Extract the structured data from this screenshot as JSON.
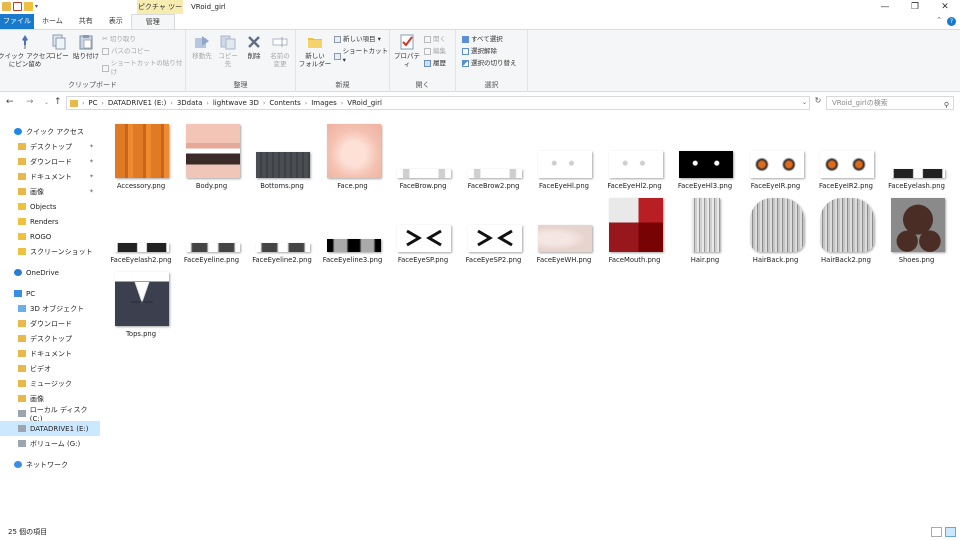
{
  "window": {
    "context_tab": "ピクチャ ツール",
    "title": "VRoid_girl"
  },
  "ribbon_tabs": [
    "ファイル",
    "ホーム",
    "共有",
    "表示",
    "管理"
  ],
  "ribbon": {
    "clipboard": {
      "label": "クリップボード",
      "pin": "クイック アクセス\nにピン留め",
      "copy": "コピー",
      "paste": "貼り付け",
      "cut": "切り取り",
      "copy_path": "パスのコピー",
      "paste_shortcut": "ショートカットの貼り付け"
    },
    "organize": {
      "label": "整理",
      "move_to": "移動先",
      "copy_to": "コピー先",
      "delete": "削除",
      "rename": "名前の\n変更"
    },
    "new": {
      "label": "新規",
      "new_folder": "新しい\nフォルダー",
      "new_item": "新しい項目 ▾",
      "shortcut": "ショートカット ▾"
    },
    "open": {
      "label": "開く",
      "properties": "プロパティ",
      "open": "開く",
      "edit": "編集",
      "history": "履歴"
    },
    "select": {
      "label": "選択",
      "select_all": "すべて選択",
      "select_none": "選択解除",
      "invert": "選択の切り替え"
    }
  },
  "address": {
    "crumbs": [
      "PC",
      "DATADRIVE1 (E:)",
      "3Ddata",
      "lightwave 3D",
      "Contents",
      "Images",
      "VRoid_girl"
    ],
    "search_placeholder": "VRoid_girlの検索"
  },
  "nav": [
    {
      "label": "クイック アクセス",
      "icon": "star-icon",
      "indent": 0,
      "pinned": false,
      "color": "#1e88e5"
    },
    {
      "label": "デスクトップ",
      "icon": "folder-icon",
      "indent": 1,
      "pinned": true,
      "color": "#e8b84a"
    },
    {
      "label": "ダウンロード",
      "icon": "download-folder-icon",
      "indent": 1,
      "pinned": true,
      "color": "#e8b84a"
    },
    {
      "label": "ドキュメント",
      "icon": "document-folder-icon",
      "indent": 1,
      "pinned": true,
      "color": "#e8b84a"
    },
    {
      "label": "画像",
      "icon": "picture-folder-icon",
      "indent": 1,
      "pinned": true,
      "color": "#e8b84a"
    },
    {
      "label": "Objects",
      "icon": "folder-icon",
      "indent": 1,
      "pinned": false,
      "color": "#f0c040"
    },
    {
      "label": "Renders",
      "icon": "folder-icon",
      "indent": 1,
      "pinned": false,
      "color": "#f0c040"
    },
    {
      "label": "ROGO",
      "icon": "folder-icon",
      "indent": 1,
      "pinned": false,
      "color": "#f0c040"
    },
    {
      "label": "スクリーンショット",
      "icon": "folder-icon",
      "indent": 1,
      "pinned": false,
      "color": "#f0c040"
    },
    {
      "label": "OneDrive",
      "icon": "cloud-icon",
      "indent": 0,
      "pinned": false,
      "color": "#2b7cd3",
      "gap": true
    },
    {
      "label": "PC",
      "icon": "pc-icon",
      "indent": 0,
      "pinned": false,
      "color": "#3a8ee6",
      "gap": true
    },
    {
      "label": "3D オブジェクト",
      "icon": "3d-objects-icon",
      "indent": 1,
      "pinned": false,
      "color": "#6ab0e8"
    },
    {
      "label": "ダウンロード",
      "icon": "download-folder-icon",
      "indent": 1,
      "pinned": false,
      "color": "#e8b84a"
    },
    {
      "label": "デスクトップ",
      "icon": "folder-icon",
      "indent": 1,
      "pinned": false,
      "color": "#e8b84a"
    },
    {
      "label": "ドキュメント",
      "icon": "document-folder-icon",
      "indent": 1,
      "pinned": false,
      "color": "#e8b84a"
    },
    {
      "label": "ビデオ",
      "icon": "video-folder-icon",
      "indent": 1,
      "pinned": false,
      "color": "#e8b84a"
    },
    {
      "label": "ミュージック",
      "icon": "music-folder-icon",
      "indent": 1,
      "pinned": false,
      "color": "#e8b84a"
    },
    {
      "label": "画像",
      "icon": "picture-folder-icon",
      "indent": 1,
      "pinned": false,
      "color": "#e8b84a"
    },
    {
      "label": "ローカル ディスク (C:)",
      "icon": "drive-icon",
      "indent": 1,
      "pinned": false,
      "color": "#9aa5ad"
    },
    {
      "label": "DATADRIVE1 (E:)",
      "icon": "drive-icon",
      "indent": 1,
      "pinned": false,
      "color": "#9aa5ad",
      "selected": true
    },
    {
      "label": "ボリューム (G:)",
      "icon": "drive-icon",
      "indent": 1,
      "pinned": false,
      "color": "#9aa5ad"
    },
    {
      "label": "ネットワーク",
      "icon": "network-icon",
      "indent": 0,
      "pinned": false,
      "color": "#3a8ee6",
      "gap": true
    }
  ],
  "files": [
    {
      "name": "Accessory.png",
      "style": "accessory"
    },
    {
      "name": "Body.png",
      "style": "body"
    },
    {
      "name": "Bottoms.png",
      "style": "bottoms"
    },
    {
      "name": "Face.png",
      "style": "face"
    },
    {
      "name": "FaceBrow.png",
      "style": "brow"
    },
    {
      "name": "FaceBrow2.png",
      "style": "brow"
    },
    {
      "name": "FaceEyeHl.png",
      "style": "eyehl"
    },
    {
      "name": "FaceEyeHl2.png",
      "style": "eyehl"
    },
    {
      "name": "FaceEyeHl3.png",
      "style": "eyehl3"
    },
    {
      "name": "FaceEyeIR.png",
      "style": "eyeir"
    },
    {
      "name": "FaceEyeIR2.png",
      "style": "eyeir"
    },
    {
      "name": "FaceEyelash.png",
      "style": "eyelash"
    },
    {
      "name": "FaceEyelash2.png",
      "style": "eyelash"
    },
    {
      "name": "FaceEyeline.png",
      "style": "eyeline"
    },
    {
      "name": "FaceEyeline2.png",
      "style": "eyeline"
    },
    {
      "name": "FaceEyeline3.png",
      "style": "eyeline3"
    },
    {
      "name": "FaceEyeSP.png",
      "style": "eyesp"
    },
    {
      "name": "FaceEyeSP2.png",
      "style": "eyesp"
    },
    {
      "name": "FaceEyeWH.png",
      "style": "eyewh"
    },
    {
      "name": "FaceMouth.png",
      "style": "mouth"
    },
    {
      "name": "Hair.png",
      "style": "hair"
    },
    {
      "name": "HairBack.png",
      "style": "hairback"
    },
    {
      "name": "HairBack2.png",
      "style": "hairback"
    },
    {
      "name": "Shoes.png",
      "style": "shoes"
    },
    {
      "name": "Tops.png",
      "style": "tops"
    }
  ],
  "status": {
    "count": "25 個の項目"
  }
}
